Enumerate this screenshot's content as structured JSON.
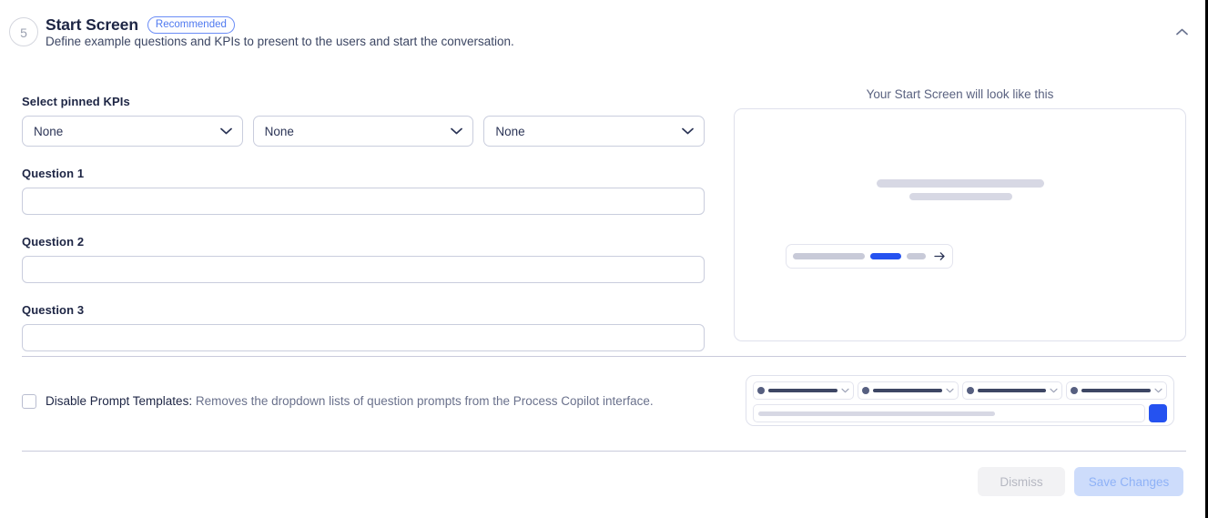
{
  "header": {
    "step_number": "5",
    "title": "Start Screen",
    "badge": "Recommended",
    "subtitle": "Define example questions and KPIs to present to the users and start the conversation.",
    "collapse_icon": "chevron-up-icon"
  },
  "form": {
    "kpi_label": "Select pinned KPIs",
    "kpi_selects": [
      {
        "value": "None",
        "chevron": "chevron-down-icon"
      },
      {
        "value": "None",
        "chevron": "chevron-down-icon"
      },
      {
        "value": "None",
        "chevron": "chevron-down-icon"
      }
    ],
    "questions": [
      {
        "label": "Question 1",
        "value": "",
        "placeholder": ""
      },
      {
        "label": "Question 2",
        "value": "",
        "placeholder": ""
      },
      {
        "label": "Question 3",
        "value": "",
        "placeholder": ""
      }
    ]
  },
  "preview": {
    "title": "Your Start Screen will look like this",
    "send_icon": "arrow-right-icon",
    "accent_color": "#2552f0",
    "skeleton_color": "#d7d8e4"
  },
  "options": {
    "disable_prompt_templates": {
      "checked": false,
      "label": "Disable Prompt Templates:",
      "description": "Removes the dropdown lists of question prompts from the Process Copilot interface."
    }
  },
  "mini_preview": {
    "dropdown_count": 4,
    "dropdown_chevron": "chevron-down-icon",
    "send_button_color": "#2552f0"
  },
  "footer": {
    "dismiss_label": "Dismiss",
    "save_label": "Save Changes",
    "dismiss_disabled": true,
    "save_disabled": true
  }
}
